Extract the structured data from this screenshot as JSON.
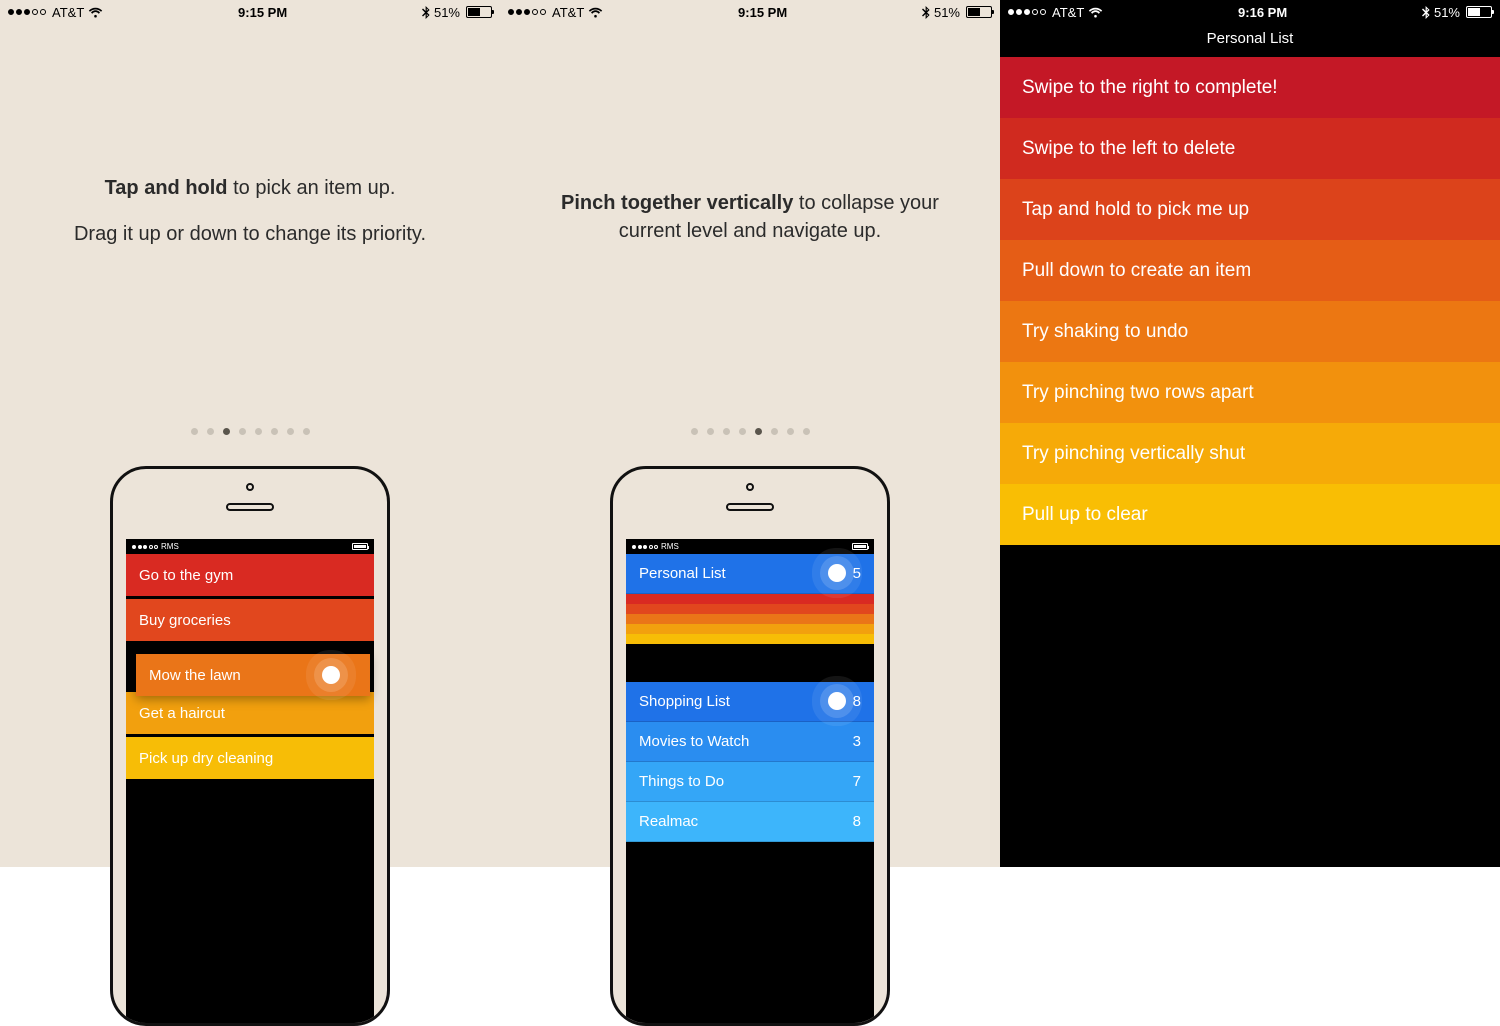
{
  "status": {
    "carrier": "AT&T",
    "time_a": "9:15 PM",
    "time_b": "9:16 PM",
    "battery_pct": "51%"
  },
  "panel1": {
    "tip_bold": "Tap and hold",
    "tip_rest": " to pick an item up.",
    "tip_line2": "Drag it up or down to change its priority.",
    "page_active": 2,
    "page_count": 8,
    "mini_carrier": "RMS",
    "tasks": [
      {
        "text": "Go to the gym",
        "color": "#d92a22"
      },
      {
        "text": "Buy groceries",
        "color": "#e1471e"
      },
      {
        "text": "Mow the lawn",
        "color": "#ea7518",
        "dragging": true
      },
      {
        "text": "Get a haircut",
        "color": "#f2a00e"
      },
      {
        "text": "Pick up dry cleaning",
        "color": "#f7bd06"
      }
    ]
  },
  "panel2": {
    "tip_bold": "Pinch together vertically",
    "tip_rest": " to collapse your current level and navigate up.",
    "page_active": 4,
    "page_count": 8,
    "mini_carrier": "RMS",
    "top_list": {
      "text": "Personal List",
      "count": "5",
      "color": "#1f72e8"
    },
    "stripe_colors": [
      "#d92a22",
      "#e1471e",
      "#ea7518",
      "#f2a00e",
      "#f7bd06"
    ],
    "bottom_lists": [
      {
        "text": "Shopping List",
        "count": "8",
        "color": "#1f72e8"
      },
      {
        "text": "Movies to Watch",
        "count": "3",
        "color": "#2a8df0"
      },
      {
        "text": "Things to Do",
        "count": "7",
        "color": "#34a6f7"
      },
      {
        "text": "Realmac",
        "count": "8",
        "color": "#3db5fb"
      }
    ]
  },
  "panel3": {
    "title": "Personal List",
    "rows": [
      {
        "text": "Swipe to the right to complete!",
        "color": "#c41826"
      },
      {
        "text": "Swipe to the left to delete",
        "color": "#d02a1f"
      },
      {
        "text": "Tap and hold to pick me up",
        "color": "#dc431b"
      },
      {
        "text": "Pull down to create an item",
        "color": "#e55d16"
      },
      {
        "text": "Try shaking to undo",
        "color": "#ec7712"
      },
      {
        "text": "Try pinching two rows apart",
        "color": "#f2910d"
      },
      {
        "text": "Try pinching vertically shut",
        "color": "#f6aa08"
      },
      {
        "text": "Pull up to clear",
        "color": "#f9be04"
      }
    ]
  }
}
